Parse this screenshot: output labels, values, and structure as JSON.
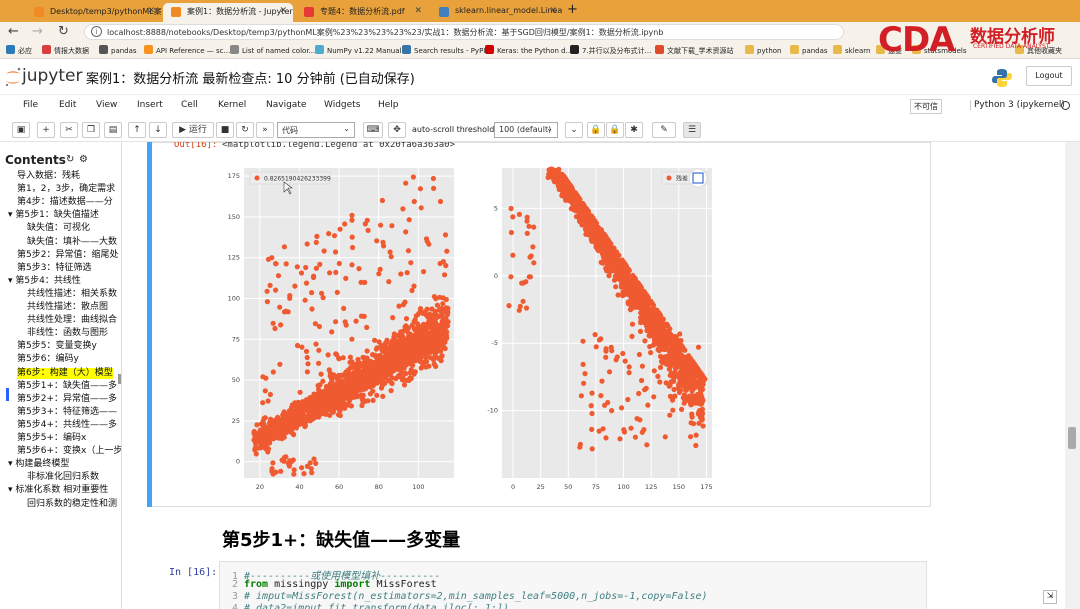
{
  "browser": {
    "tabs": [
      {
        "label": "Desktop/temp3/pythonML案例/...",
        "color": "#f08a24"
      },
      {
        "label": "案例1：数据分析流 - Jupyter No...",
        "color": "#f08a24"
      },
      {
        "label": "专题4：数据分析流.pdf",
        "color": "#e53935"
      },
      {
        "label": "sklearn.linear_model.LinearRegre...",
        "color": "#3f7fbf"
      }
    ],
    "url": "localhost:8888/notebooks/Desktop/temp3/pythonML案例%23%23%23%23%23/实战1：数据分析流：基于SGD回归模型/案例1：数据分析流.ipynb",
    "bookmarks": [
      "必应",
      "情报大数据",
      "pandas",
      "API Reference — sc...",
      "List of named color...",
      "NumPy v1.22 Manual",
      "Search results - PyPI",
      "Keras: the Python d...",
      "7.并行以及分布式计...",
      "文献下载_学术资源站",
      "python",
      "pandas",
      "sklearn",
      "速查",
      "statsmodels",
      "其他收藏夹"
    ]
  },
  "watermark": {
    "brand": "CDA",
    "cn": "数据分析师",
    "en": "CERTIFIED DATA ANALYST"
  },
  "jupyter": {
    "logo_text": "jupyter",
    "notebook_title": "案例1：数据分析流 最新检查点: 10 分钟前   (已自动保存)",
    "logout": "Logout",
    "menus": [
      "File",
      "Edit",
      "View",
      "Insert",
      "Cell",
      "Kernel",
      "Navigate",
      "Widgets",
      "Help"
    ],
    "trusted": "不可信",
    "kernel": "Python 3 (ipykernel)",
    "toolbar": {
      "run": "▶ 运行",
      "cell_type": "代码",
      "auto_scroll_label": "auto-scroll threshold:",
      "auto_scroll_value": "100 (default)"
    }
  },
  "toc": {
    "title": "Contents",
    "items": [
      {
        "text": "导入数据：残耗",
        "indent": 0,
        "highlight": false
      },
      {
        "text": "第1，2，3步，确定需求",
        "indent": 0,
        "highlight": false
      },
      {
        "text": "第4步：描述数据——分",
        "indent": 0,
        "highlight": false
      },
      {
        "text": "▾ 第5步1：缺失值描述",
        "indent": 0,
        "highlight": false
      },
      {
        "text": "缺失值：可视化",
        "indent": 1,
        "highlight": false
      },
      {
        "text": "缺失值：填补——大数",
        "indent": 1,
        "highlight": false
      },
      {
        "text": "第5步2：异常值：缩尾处",
        "indent": 0,
        "highlight": false
      },
      {
        "text": "第5步3：特征筛选",
        "indent": 0,
        "highlight": false
      },
      {
        "text": "▾ 第5步4：共线性",
        "indent": 0,
        "highlight": false
      },
      {
        "text": "共线性描述：相关系数",
        "indent": 1,
        "highlight": false
      },
      {
        "text": "共线性描述：散点图",
        "indent": 1,
        "highlight": false
      },
      {
        "text": "共线性处理：曲线拟合",
        "indent": 1,
        "highlight": false
      },
      {
        "text": "非线性：函数与图形",
        "indent": 1,
        "highlight": false
      },
      {
        "text": "第5步5：变量变换y",
        "indent": 0,
        "highlight": false
      },
      {
        "text": "第5步6：编码y",
        "indent": 0,
        "highlight": false
      },
      {
        "text": "第6步：构建（大）模型",
        "indent": 0,
        "highlight": true
      },
      {
        "text": "第5步1+：缺失值——多",
        "indent": 0,
        "highlight": false
      },
      {
        "text": "第5步2+：异常值——多",
        "indent": 0,
        "highlight": false
      },
      {
        "text": "第5步3+：特征筛选——",
        "indent": 0,
        "highlight": false
      },
      {
        "text": "第5步4+：共线性——多",
        "indent": 0,
        "highlight": false
      },
      {
        "text": "第5步5+：编码x",
        "indent": 0,
        "highlight": false
      },
      {
        "text": "第5步6+：变换x（上一步",
        "indent": 0,
        "highlight": false
      },
      {
        "text": "▾ 构建最终模型",
        "indent": 0,
        "highlight": false
      },
      {
        "text": "非标准化回归系数",
        "indent": 1,
        "highlight": false
      },
      {
        "text": "▾ 标准化系数 相对重要性",
        "indent": 0,
        "highlight": false
      },
      {
        "text": "回归系数的稳定性和测",
        "indent": 1,
        "highlight": false
      }
    ]
  },
  "cell_output": {
    "out_label": "Out[16]:",
    "out_text": "<matplotlib.legend.Legend at 0x20fa6a363a0>"
  },
  "chart_data": [
    {
      "type": "scatter",
      "title": "",
      "legend": [
        "0.8265190426233399"
      ],
      "legend_position": "top-left",
      "color": "#f05a30",
      "grid": true,
      "xlim": [
        12,
        118
      ],
      "ylim": [
        -10,
        180
      ],
      "xticks": [
        20,
        40,
        60,
        80,
        100
      ],
      "yticks": [
        0,
        25,
        50,
        75,
        100,
        125,
        150,
        175
      ],
      "xlabel": "",
      "ylabel": ""
    },
    {
      "type": "scatter",
      "title": "",
      "legend": [
        "残差"
      ],
      "legend_position": "top-right",
      "color": "#f05a30",
      "grid": true,
      "xlim": [
        -10,
        180
      ],
      "ylim": [
        -15,
        8
      ],
      "xticks": [
        0,
        25,
        50,
        75,
        100,
        125,
        150,
        175
      ],
      "yticks": [
        -10,
        -5,
        0,
        5
      ],
      "xlabel": "",
      "ylabel": ""
    }
  ],
  "markdown_heading": "第5步1+：缺失值——多变量",
  "code_cell": {
    "in_label": "In  [16]:",
    "lines": [
      {
        "n": "1",
        "text": "#----------或使用模型填补----------",
        "kind": "comment"
      },
      {
        "n": "2",
        "kw": "from",
        "mid": " missingpy ",
        "kw2": "import",
        "rest": " MissForest",
        "kind": "import"
      },
      {
        "n": "3",
        "text": "# imput=MissForest(n_estimators=2,min_samples_leaf=5000,n_jobs=-1,copy=False)",
        "kind": "comment"
      },
      {
        "n": "4",
        "text": "# data2=imput.fit_transform(data.iloc[:,1:])",
        "kind": "comment"
      }
    ]
  }
}
